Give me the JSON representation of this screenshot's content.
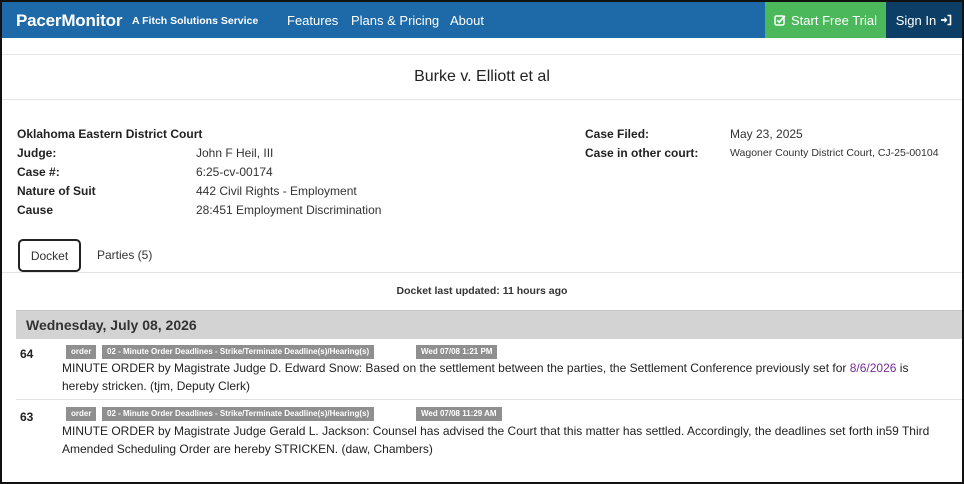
{
  "nav": {
    "brand": "PacerMonitor",
    "tagline": "A Fitch Solutions Service",
    "links": [
      "Features",
      "Plans & Pricing",
      "About"
    ],
    "trial_label": "Start Free Trial",
    "signin_label": "Sign In",
    "colors": {
      "nav_bg": "#1e6aa8",
      "trial_bg": "#4cb85c",
      "signin_bg": "#0d3f66"
    }
  },
  "case": {
    "title": "Burke v. Elliott et al",
    "court": "Oklahoma Eastern District Court",
    "fields_left": [
      {
        "label": "Judge:",
        "value": "John F Heil, III"
      },
      {
        "label": "Case #:",
        "value": "6:25-cv-00174"
      },
      {
        "label": "Nature of Suit",
        "value": "442 Civil Rights - Employment"
      },
      {
        "label": "Cause",
        "value": "28:451 Employment Discrimination"
      }
    ],
    "fields_right": [
      {
        "label": "Case Filed:",
        "value": "May 23, 2025"
      },
      {
        "label": "Case in other court:",
        "value": "Wagoner County District Court, CJ-25-00104"
      }
    ]
  },
  "tabs": {
    "docket": "Docket",
    "parties": "Parties (5)"
  },
  "docket": {
    "last_updated": "Docket last updated: 11 hours ago",
    "date_header": "Wednesday, July 08, 2026",
    "entries": [
      {
        "number": "64",
        "type_badge": "order",
        "category_badge": "02 - Minute Order Deadlines - Strike/Terminate Deadline(s)/Hearing(s)",
        "time_badge": "Wed 07/08 1:21 PM",
        "text_before": "MINUTE ORDER by Magistrate Judge D. Edward Snow: Based on the settlement between the parties, the Settlement Conference previously set for ",
        "link": "8/6/2026",
        "text_after": " is hereby stricken. (tjm, Deputy Clerk)"
      },
      {
        "number": "63",
        "type_badge": "order",
        "category_badge": "02 - Minute Order Deadlines - Strike/Terminate Deadline(s)/Hearing(s)",
        "time_badge": "Wed 07/08 11:29 AM",
        "text": "MINUTE ORDER by Magistrate Judge Gerald L. Jackson: Counsel has advised the Court that this matter has settled. Accordingly, the deadlines set forth in59 Third Amended Scheduling Order are hereby STRICKEN. (daw, Chambers)"
      }
    ]
  }
}
